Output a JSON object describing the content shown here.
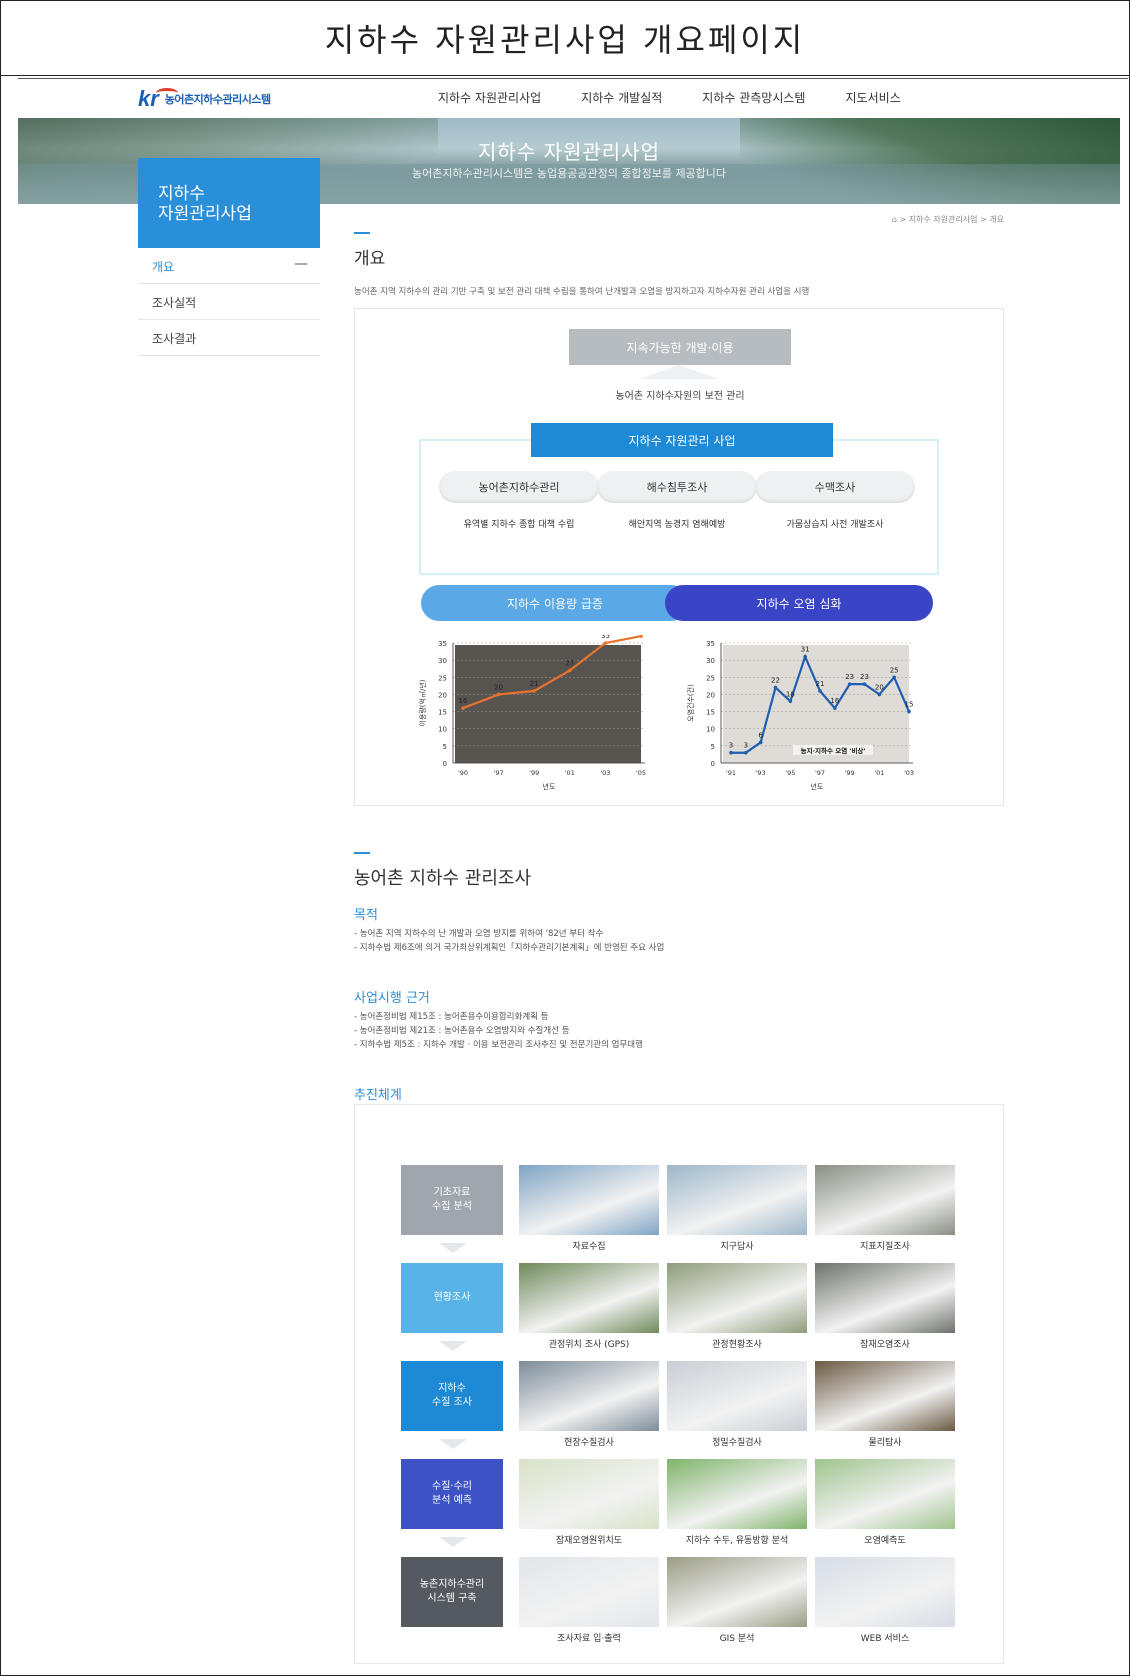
{
  "doc_title": "지하수 자원관리사업 개요페이지",
  "header": {
    "logo_text": "농어촌지하수관리시스템",
    "nav": [
      "지하수 자원관리사업",
      "지하수 개발실적",
      "지하수 관측망시스템",
      "지도서비스"
    ]
  },
  "banner": {
    "title": "지하수 자원관리사업",
    "subtitle": "농어촌지하수관리시스템은 농업용공공관정의 종합정보를 제공합니다"
  },
  "sidebar": {
    "title_line1": "지하수",
    "title_line2": "자원관리사업",
    "items": [
      {
        "label": "개요"
      },
      {
        "label": "조사실적"
      },
      {
        "label": "조사결과"
      }
    ]
  },
  "breadcrumb": "> 지하수 자원관리사업 > 개요",
  "overview": {
    "title": "개요",
    "description": "농어촌 지역 지하수의 관리 기반 구축 및 보전 관리 대책 수립을 통하여 난개발과 오염을 방지하고자 지하수자원 관리 사업을 시행"
  },
  "diagram": {
    "top": "지속가능한 개발·이용",
    "middle": "농어촌 지하수자원의 보전 관리",
    "blue": "지하수 자원관리 사업",
    "pills": [
      {
        "label": "농어촌지하수관리",
        "caption": "유역별 지하수 종합 대책 수립"
      },
      {
        "label": "해수침투조사",
        "caption": "해안지역 농경지 염해예방"
      },
      {
        "label": "수맥조사",
        "caption": "가뭄상습지 사전 개발조사"
      }
    ],
    "left_pill": "지하수 이용량 급증",
    "right_pill": "지하수 오염 심화",
    "left_chart_ylabel": "이용량(억㎥/년)",
    "right_chart_ylabel": "오염건수(건)",
    "xlabel": "년도",
    "right_chart_caption": "농지·지하수 오염 '비상'"
  },
  "chart_data": [
    {
      "type": "line",
      "x": [
        "'90",
        "'97",
        "'99",
        "'01",
        "'03",
        "'05"
      ],
      "values": [
        16,
        20,
        21,
        27,
        35,
        37
      ],
      "ylim": [
        0,
        35
      ],
      "yticks": [
        0,
        5,
        10,
        15,
        20,
        25,
        30,
        35
      ],
      "ylabel": "이용량(억㎥/년)",
      "xlabel": "년도",
      "color": "#e8732e"
    },
    {
      "type": "line",
      "x": [
        "'91",
        "'92",
        "'93",
        "'94",
        "'95",
        "'96",
        "'97",
        "'98",
        "'99",
        "'00",
        "'01",
        "'02",
        "'03"
      ],
      "values": [
        3,
        3,
        6,
        22,
        18,
        31,
        21,
        16,
        23,
        23,
        20,
        25,
        15
      ],
      "ylim": [
        0,
        35
      ],
      "yticks": [
        0,
        5,
        10,
        15,
        20,
        25,
        30,
        35
      ],
      "xticks": [
        "'91",
        "'93",
        "'95",
        "'97",
        "'99",
        "'01",
        "'03"
      ],
      "ylabel": "오염건수(건)",
      "xlabel": "년도",
      "color": "#1f5fb0"
    }
  ],
  "survey": {
    "title": "농어촌 지하수 관리조사",
    "purpose_title": "목적",
    "purpose": [
      "- 농어촌 지역 지하수의 난 개발과 오염 방지를 위하여 '82년 부터 착수",
      "- 지하수법 제6조에 의거 국가최상위계획인「지하수관리기본계획」에 반영된 주요 사업"
    ],
    "basis_title": "사업시행 근거",
    "basis": [
      "- 농어촌정비법 제15조 : 농어촌용수이용합리화계획 등",
      "- 농어촌정비법 제21조 : 농어촌용수 오염방지와 수질개선 등",
      "- 지하수법 제5조 : 지하수 개발 · 이용 보전관리 조사추진 및 전문기관의 업무대행"
    ],
    "system_title": "추진체계"
  },
  "flow": {
    "steps": [
      {
        "label1": "기초자료",
        "label2": "수집 분석",
        "color": "#9fa6ae",
        "photos": [
          "자료수집",
          "지구답사",
          "지표지질조사"
        ]
      },
      {
        "label1": "현황조사",
        "label2": "",
        "color": "#58b4e8",
        "photos": [
          "관정위치 조사 (GPS)",
          "관정현황조사",
          "잠재오염조사"
        ]
      },
      {
        "label1": "지하수",
        "label2": "수질 조사",
        "color": "#1e8ad6",
        "photos": [
          "현장수질검사",
          "정밀수질검사",
          "물리탐사"
        ]
      },
      {
        "label1": "수질·수리",
        "label2": "분석 예측",
        "color": "#3d52c4",
        "photos": [
          "잠재오염원위치도",
          "지하수 수두, 유동방향 분석",
          "오염예측도"
        ]
      },
      {
        "label1": "농촌지하수관리",
        "label2": "시스템 구축",
        "color": "#555a60",
        "photos": [
          "조사자료 입·출력",
          "GIS 분석",
          "WEB 서비스"
        ]
      }
    ]
  }
}
